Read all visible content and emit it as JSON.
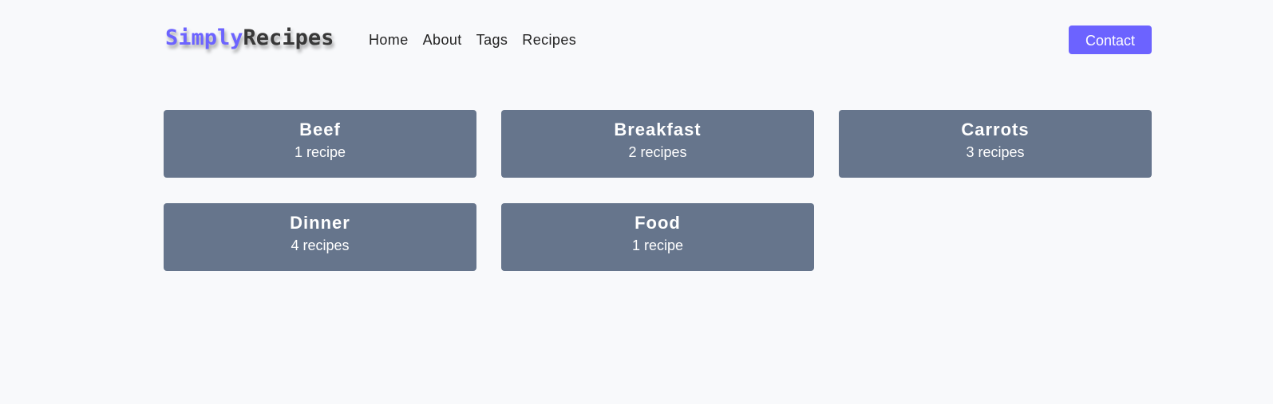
{
  "brand": {
    "part_a": "Simply",
    "part_b": "Recipes",
    "accent_color": "#6c63ff"
  },
  "nav": {
    "links": [
      {
        "label": "Home"
      },
      {
        "label": "About"
      },
      {
        "label": "Tags"
      },
      {
        "label": "Recipes"
      }
    ],
    "contact_label": "Contact"
  },
  "tags": [
    {
      "name": "Beef",
      "count": "1 recipe"
    },
    {
      "name": "Breakfast",
      "count": "2 recipes"
    },
    {
      "name": "Carrots",
      "count": "3 recipes"
    },
    {
      "name": "Dinner",
      "count": "4 recipes"
    },
    {
      "name": "Food",
      "count": "1 recipe"
    }
  ],
  "colors": {
    "card_bg": "#66758c",
    "page_bg": "#f8f9fb"
  }
}
